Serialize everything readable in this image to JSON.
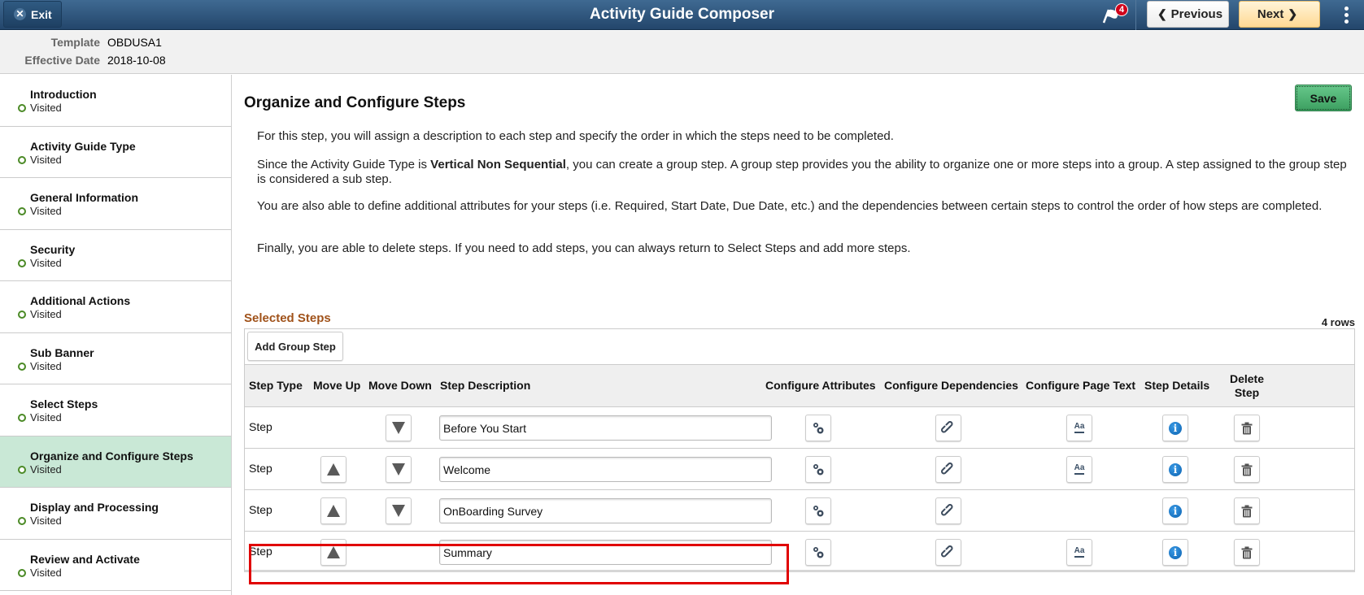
{
  "header": {
    "exit_label": "Exit",
    "title": "Activity Guide Composer",
    "notifications_count": "4",
    "previous_label": "Previous",
    "next_label": "Next"
  },
  "info": {
    "template_label": "Template",
    "template_value": "OBDUSA1",
    "effective_date_label": "Effective Date",
    "effective_date_value": "2018-10-08"
  },
  "sidebar": {
    "items": [
      {
        "label": "Introduction",
        "status": "Visited"
      },
      {
        "label": "Activity Guide Type",
        "status": "Visited"
      },
      {
        "label": "General Information",
        "status": "Visited"
      },
      {
        "label": "Security",
        "status": "Visited"
      },
      {
        "label": "Additional Actions",
        "status": "Visited"
      },
      {
        "label": "Sub Banner",
        "status": "Visited"
      },
      {
        "label": "Select Steps",
        "status": "Visited"
      },
      {
        "label": "Organize and Configure Steps",
        "status": "Visited",
        "active": true
      },
      {
        "label": "Display and Processing",
        "status": "Visited"
      },
      {
        "label": "Review and Activate",
        "status": "Visited"
      }
    ]
  },
  "main": {
    "title": "Organize and Configure Steps",
    "save_label": "Save",
    "paragraphs": {
      "p1": "For this step, you will assign a description to each step and specify the order in which the steps need to be completed.",
      "p2_before": "Since the Activity Guide Type is ",
      "p2_bold": "Vertical Non Sequential",
      "p2_after": ", you can create a group step. A group step provides you the ability to organize one or more steps into a group. A step assigned to the group step is considered a sub step.",
      "p3": "You are also able to define additional attributes for your steps (i.e. Required, Start Date, Due Date, etc.) and the dependencies between certain steps to control the order of how steps are completed.",
      "p4": "Finally, you are able to delete steps. If you need to add steps, you can always return to Select Steps and add more steps."
    },
    "section_title": "Selected Steps",
    "row_count": "4 rows",
    "add_group_step_label": "Add Group Step",
    "columns": {
      "step_type": "Step Type",
      "move_up": "Move Up",
      "move_down": "Move Down",
      "step_description": "Step Description",
      "configure_attributes": "Configure Attributes",
      "configure_dependencies": "Configure Dependencies",
      "configure_page_text": "Configure Page Text",
      "step_details": "Step Details",
      "delete_step_line1": "Delete",
      "delete_step_line2": "Step"
    },
    "rows": [
      {
        "type": "Step",
        "description": "Before You Start",
        "move_up": false,
        "move_down": true,
        "page_text": true
      },
      {
        "type": "Step",
        "description": "Welcome",
        "move_up": true,
        "move_down": true,
        "page_text": true
      },
      {
        "type": "Step",
        "description": "OnBoarding Survey",
        "move_up": true,
        "move_down": true,
        "page_text": false,
        "highlighted": true
      },
      {
        "type": "Step",
        "description": "Summary",
        "move_up": true,
        "move_down": false,
        "page_text": true
      }
    ]
  }
}
